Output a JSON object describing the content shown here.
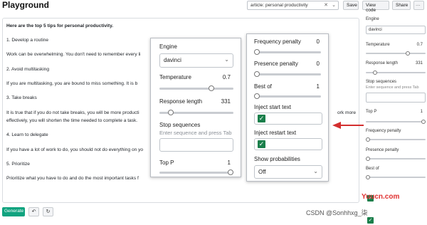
{
  "header": {
    "title": "Playground",
    "preset_value": "article: personal productivity",
    "save_label": "Save",
    "view_code_label": "View code",
    "share_label": "Share",
    "more_label": "···"
  },
  "editor": {
    "lines": [
      "Here are the top 5 tips for personal productivity.",
      "1. Develop a routine",
      "Work can be overwhelming. You don't need to remember every li",
      "2. Avoid multitasking",
      "If you are multitasking, you are bound to miss something. It is b",
      "3. Take breaks",
      "It is true that if you do not take breaks, you will be more producti",
      "effectively, you will shorten the time needed to complete a task.",
      "4. Learn to delegate",
      "If you have a lot of work to do, you should not do everything on yo",
      "5. Prioritize",
      "Prioritize what you have to do and do the most important tasks f"
    ],
    "overflow_text": "ork more"
  },
  "footer": {
    "generate_label": "Generate",
    "undo_icon": "↶",
    "regenerate_icon": "↻"
  },
  "sidebar": {
    "engine_label": "Engine",
    "engine_value": "davinci",
    "temperature_label": "Temperature",
    "temperature_value": "0.7",
    "response_length_label": "Response length",
    "response_length_value": "331",
    "stop_sequences_label": "Stop sequences",
    "stop_sequences_hint": "Enter sequence and press Tab",
    "top_p_label": "Top P",
    "top_p_value": "1",
    "frequency_penalty_label": "Frequency penalty",
    "frequency_penalty_value": "0",
    "presence_penalty_label": "Presence penalty",
    "presence_penalty_value": "0",
    "best_of_label": "Best of",
    "best_of_value": "1",
    "inject_start_label": "Inject start text",
    "inject_restart_label": "Inject restart text",
    "show_probabilities_label": "Show probabilities",
    "show_probabilities_value": "Off"
  },
  "levels": {
    "temperature": 0.7,
    "response_length": 0.15,
    "top_p": 1.0,
    "frequency_penalty": 0.0,
    "presence_penalty": 0.0,
    "best_of": 0.0
  },
  "watermark": {
    "site": "Yuucn.com",
    "csdn": "CSDN @Sonhhxg_柒"
  },
  "colors": {
    "accent": "#10a37f",
    "check": "#1a7f4b",
    "arrow": "#d32f2f"
  }
}
